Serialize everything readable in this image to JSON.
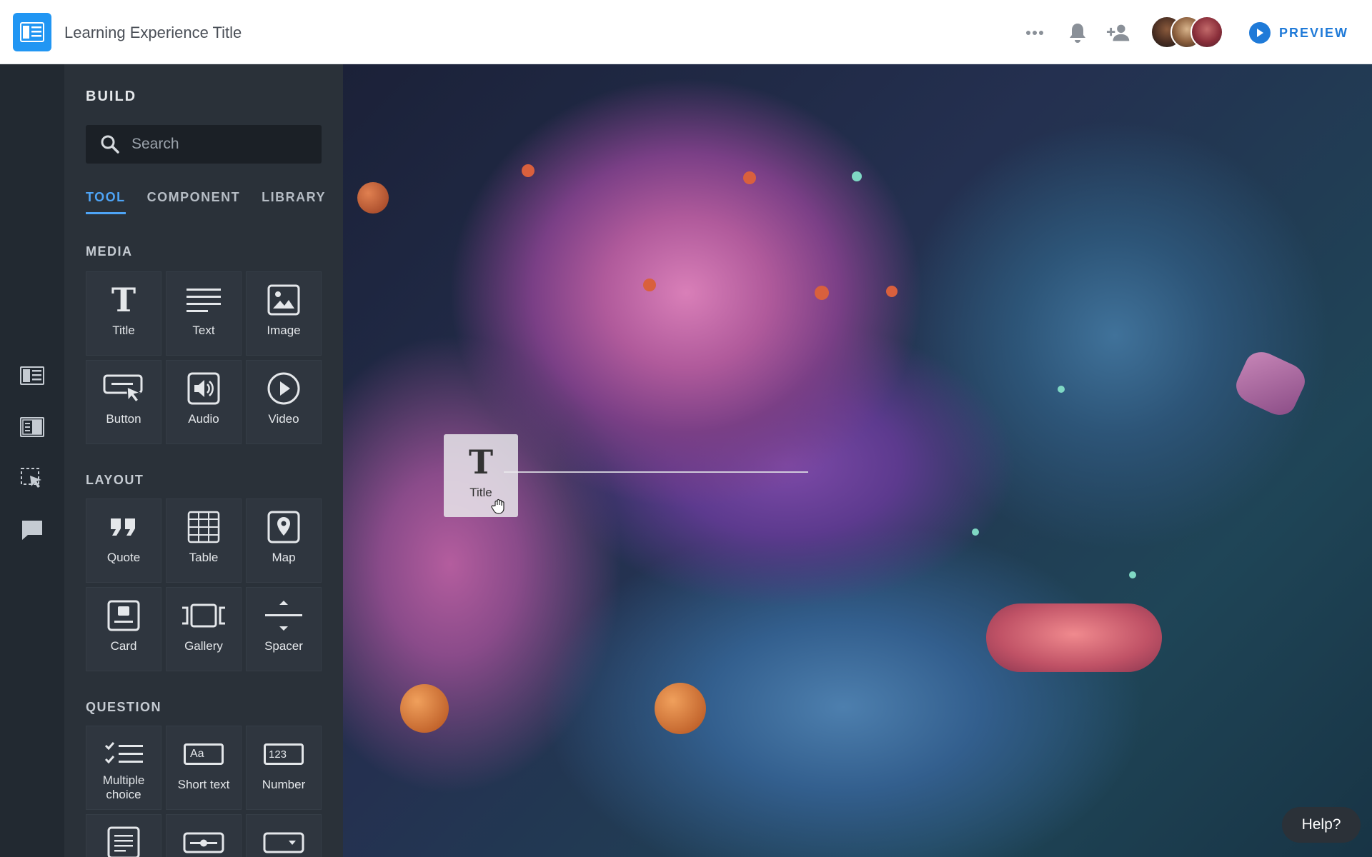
{
  "header": {
    "title": "Learning Experience Title",
    "preview_label": "PREVIEW"
  },
  "build": {
    "title": "BUILD",
    "search_placeholder": "Search",
    "tabs": [
      {
        "label": "TOOL",
        "active": true
      },
      {
        "label": "COMPONENT",
        "active": false
      },
      {
        "label": "LIBRARY",
        "active": false
      }
    ],
    "sections": {
      "media": {
        "label": "MEDIA",
        "items": [
          {
            "label": "Title",
            "icon": "title-icon"
          },
          {
            "label": "Text",
            "icon": "text-lines-icon"
          },
          {
            "label": "Image",
            "icon": "image-icon"
          },
          {
            "label": "Button",
            "icon": "button-cursor-icon"
          },
          {
            "label": "Audio",
            "icon": "speaker-icon"
          },
          {
            "label": "Video",
            "icon": "play-circle-icon"
          }
        ]
      },
      "layout": {
        "label": "LAYOUT",
        "items": [
          {
            "label": "Quote",
            "icon": "quote-icon"
          },
          {
            "label": "Table",
            "icon": "table-grid-icon"
          },
          {
            "label": "Map",
            "icon": "map-pin-icon"
          },
          {
            "label": "Card",
            "icon": "card-icon"
          },
          {
            "label": "Gallery",
            "icon": "gallery-icon"
          },
          {
            "label": "Spacer",
            "icon": "spacer-icon"
          }
        ]
      },
      "question": {
        "label": "QUESTION",
        "items": [
          {
            "label": "Multiple choice",
            "icon": "checklist-icon"
          },
          {
            "label": "Short text",
            "icon": "text-field-icon",
            "icon_text": "Aa"
          },
          {
            "label": "Number",
            "icon": "number-field-icon",
            "icon_text": "123"
          },
          {
            "label": "",
            "icon": "long-text-icon"
          },
          {
            "label": "",
            "icon": "slider-icon"
          },
          {
            "label": "",
            "icon": "dropdown-icon"
          }
        ]
      }
    }
  },
  "drag": {
    "label": "Title",
    "glyph": "T"
  },
  "tiles": {
    "title_glyph": "T"
  },
  "help_label": "Help?",
  "colors": {
    "accent": "#1f7ad8",
    "logo": "#2196f3",
    "tab_active": "#4ea4f6",
    "panel": "#2a3139",
    "rail": "#222931"
  }
}
